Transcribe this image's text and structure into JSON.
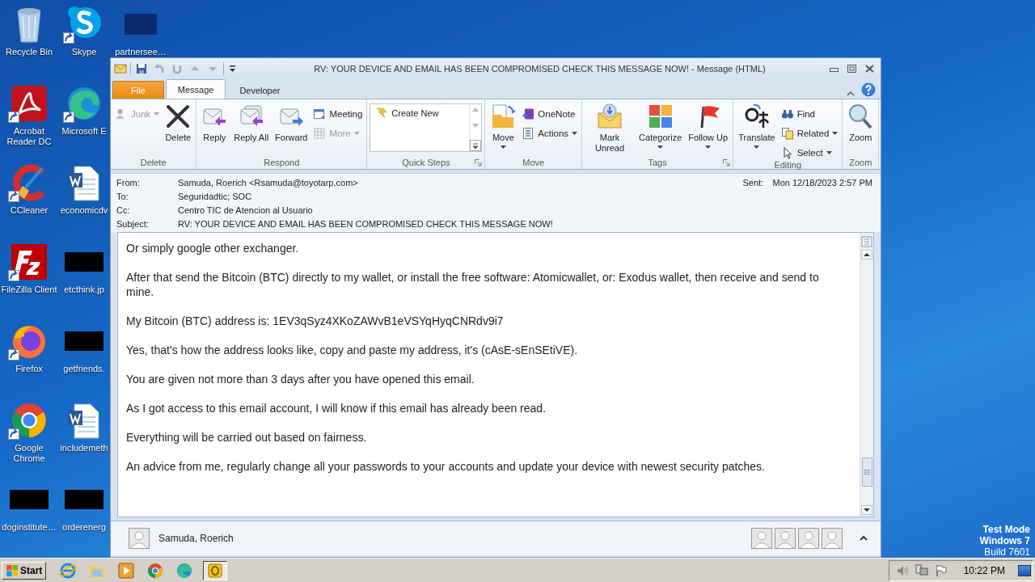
{
  "desktop": {
    "icons": [
      {
        "label": "Recycle Bin",
        "kind": "recycle",
        "shortcut": false
      },
      {
        "label": "Acrobat Reader DC",
        "kind": "acrobat",
        "shortcut": true
      },
      {
        "label": "CCleaner",
        "kind": "ccleaner",
        "shortcut": true
      },
      {
        "label": "FileZilla Client",
        "kind": "filezilla",
        "shortcut": true
      },
      {
        "label": "Firefox",
        "kind": "firefox",
        "shortcut": true
      },
      {
        "label": "Google Chrome",
        "kind": "chrome",
        "shortcut": true
      },
      {
        "label": "doginstitute…",
        "kind": "redacted",
        "shortcut": false
      },
      {
        "label": "Skype",
        "kind": "skype",
        "shortcut": true
      },
      {
        "label": "Microsoft E",
        "kind": "edge",
        "shortcut": true
      },
      {
        "label": "economicdv",
        "kind": "word",
        "shortcut": false
      },
      {
        "label": "etcthink.jp",
        "kind": "redacted",
        "shortcut": false
      },
      {
        "label": "getfriends.",
        "kind": "redacted",
        "shortcut": false
      },
      {
        "label": "includemeth",
        "kind": "word",
        "shortcut": false
      },
      {
        "label": "orderenerg",
        "kind": "redacted",
        "shortcut": false
      },
      {
        "label": "partnersee…",
        "kind": "file",
        "shortcut": false
      }
    ],
    "os_notice": [
      {
        "text": "Test Mode",
        "bold": true
      },
      {
        "text": "Windows 7",
        "bold": true
      },
      {
        "text": "Build 7601",
        "bold": false
      }
    ]
  },
  "window": {
    "title": "RV: YOUR DEVICE AND EMAIL HAS BEEN COMPROMISED CHECK THIS MESSAGE NOW!  -  Message (HTML)"
  },
  "tabs": [
    {
      "label": "File",
      "kind": "file",
      "selected": false
    },
    {
      "label": "Message",
      "kind": "normal",
      "selected": true
    },
    {
      "label": "Developer",
      "kind": "normal",
      "selected": false
    }
  ],
  "ribbon": {
    "groups": [
      {
        "label": "Delete",
        "kind": "buttons",
        "launcher": false,
        "items": [
          {
            "label": "Junk",
            "kind": "junk",
            "large": false,
            "disabled": true,
            "dropdown": true
          },
          {
            "label": "Delete",
            "kind": "delete",
            "large": true,
            "disabled": false,
            "dropdown": false
          }
        ]
      },
      {
        "label": "Respond",
        "kind": "buttons",
        "launcher": false,
        "items": [
          {
            "label": "Reply",
            "kind": "reply",
            "large": true,
            "disabled": false,
            "dropdown": false
          },
          {
            "label": "Reply All",
            "kind": "reply_all",
            "large": true,
            "disabled": false,
            "dropdown": false
          },
          {
            "label": "Forward",
            "kind": "forward",
            "large": true,
            "disabled": false,
            "dropdown": false
          },
          {
            "label": "Meeting",
            "kind": "meeting",
            "large": false,
            "disabled": false,
            "dropdown": false
          },
          {
            "label": "More",
            "kind": "more",
            "large": false,
            "disabled": true,
            "dropdown": true
          }
        ]
      },
      {
        "label": "Quick Steps",
        "kind": "gallery",
        "launcher": true,
        "items": [
          {
            "label": "Create New",
            "kind": "quickstep",
            "large": false,
            "disabled": false,
            "dropdown": false
          }
        ]
      },
      {
        "label": "Move",
        "kind": "buttons",
        "launcher": false,
        "items": [
          {
            "label": "Move",
            "kind": "move",
            "large": true,
            "disabled": false,
            "dropdown": true
          },
          {
            "label": "OneNote",
            "kind": "onenote",
            "large": false,
            "disabled": false,
            "dropdown": false
          },
          {
            "label": "Actions",
            "kind": "actions",
            "large": false,
            "disabled": false,
            "dropdown": true
          }
        ]
      },
      {
        "label": "Tags",
        "kind": "buttons",
        "launcher": true,
        "items": [
          {
            "label": "Mark Unread",
            "kind": "mark_unread",
            "large": true,
            "disabled": false,
            "dropdown": false
          },
          {
            "label": "Categorize",
            "kind": "categorize",
            "large": true,
            "disabled": false,
            "dropdown": true
          },
          {
            "label": "Follow Up",
            "kind": "follow_up",
            "large": true,
            "disabled": false,
            "dropdown": true
          }
        ]
      },
      {
        "label": "Editing",
        "kind": "buttons",
        "launcher": false,
        "items": [
          {
            "label": "Translate",
            "kind": "translate",
            "large": true,
            "disabled": false,
            "dropdown": true
          },
          {
            "label": "Find",
            "kind": "find",
            "large": false,
            "disabled": false,
            "dropdown": false
          },
          {
            "label": "Related",
            "kind": "related",
            "large": false,
            "disabled": false,
            "dropdown": true
          },
          {
            "label": "Select",
            "kind": "select",
            "large": false,
            "disabled": false,
            "dropdown": true
          }
        ]
      },
      {
        "label": "Zoom",
        "kind": "buttons",
        "launcher": false,
        "items": [
          {
            "label": "Zoom",
            "kind": "zoom",
            "large": true,
            "disabled": false,
            "dropdown": false
          }
        ]
      }
    ]
  },
  "header": {
    "fields": [
      {
        "label": "From:",
        "value": "Samuda, Roerich <Rsamuda@toyotarp.com>"
      },
      {
        "label": "To:",
        "value": "Seguridadtic; SOC"
      },
      {
        "label": "Cc:",
        "value": "Centro TIC de Atencion al Usuario"
      },
      {
        "label": "Subject:",
        "value": "RV: YOUR DEVICE AND EMAIL HAS BEEN COMPROMISED CHECK THIS MESSAGE NOW!"
      }
    ],
    "sent": {
      "label": "Sent:",
      "value": "Mon 12/18/2023 2:57 PM"
    }
  },
  "body": {
    "paragraphs": [
      "Or simply google other exchanger.",
      "After that send the Bitcoin (BTC) directly to my wallet, or install the free software: Atomicwallet, or: Exodus wallet, then receive and send to mine.",
      "My Bitcoin (BTC) address is: 1EV3qSyz4XKoZAWvB1eVSYqHyqCNRdv9i7",
      "Yes, that's how the address looks like, copy and paste my address, it's (cAsE-sEnSEtiVE).",
      "You are given not more than 3 days after you have opened this email.",
      "As I got access to this email account, I will know if this email has already been read.",
      "Everything will be carried out based on fairness.",
      "An advice from me, regularly change all your passwords to your accounts and update your device with newest security patches."
    ]
  },
  "people_pane": {
    "name": "Samuda, Roerich"
  },
  "taskbar": {
    "start": "Start",
    "apps": [
      {
        "kind": "ie",
        "selected": false
      },
      {
        "kind": "explorer",
        "selected": false
      },
      {
        "kind": "media",
        "selected": false
      },
      {
        "kind": "chrome",
        "selected": false
      },
      {
        "kind": "edge",
        "selected": false
      },
      {
        "kind": "outlook",
        "selected": true
      }
    ],
    "clock": "10:22 PM"
  }
}
